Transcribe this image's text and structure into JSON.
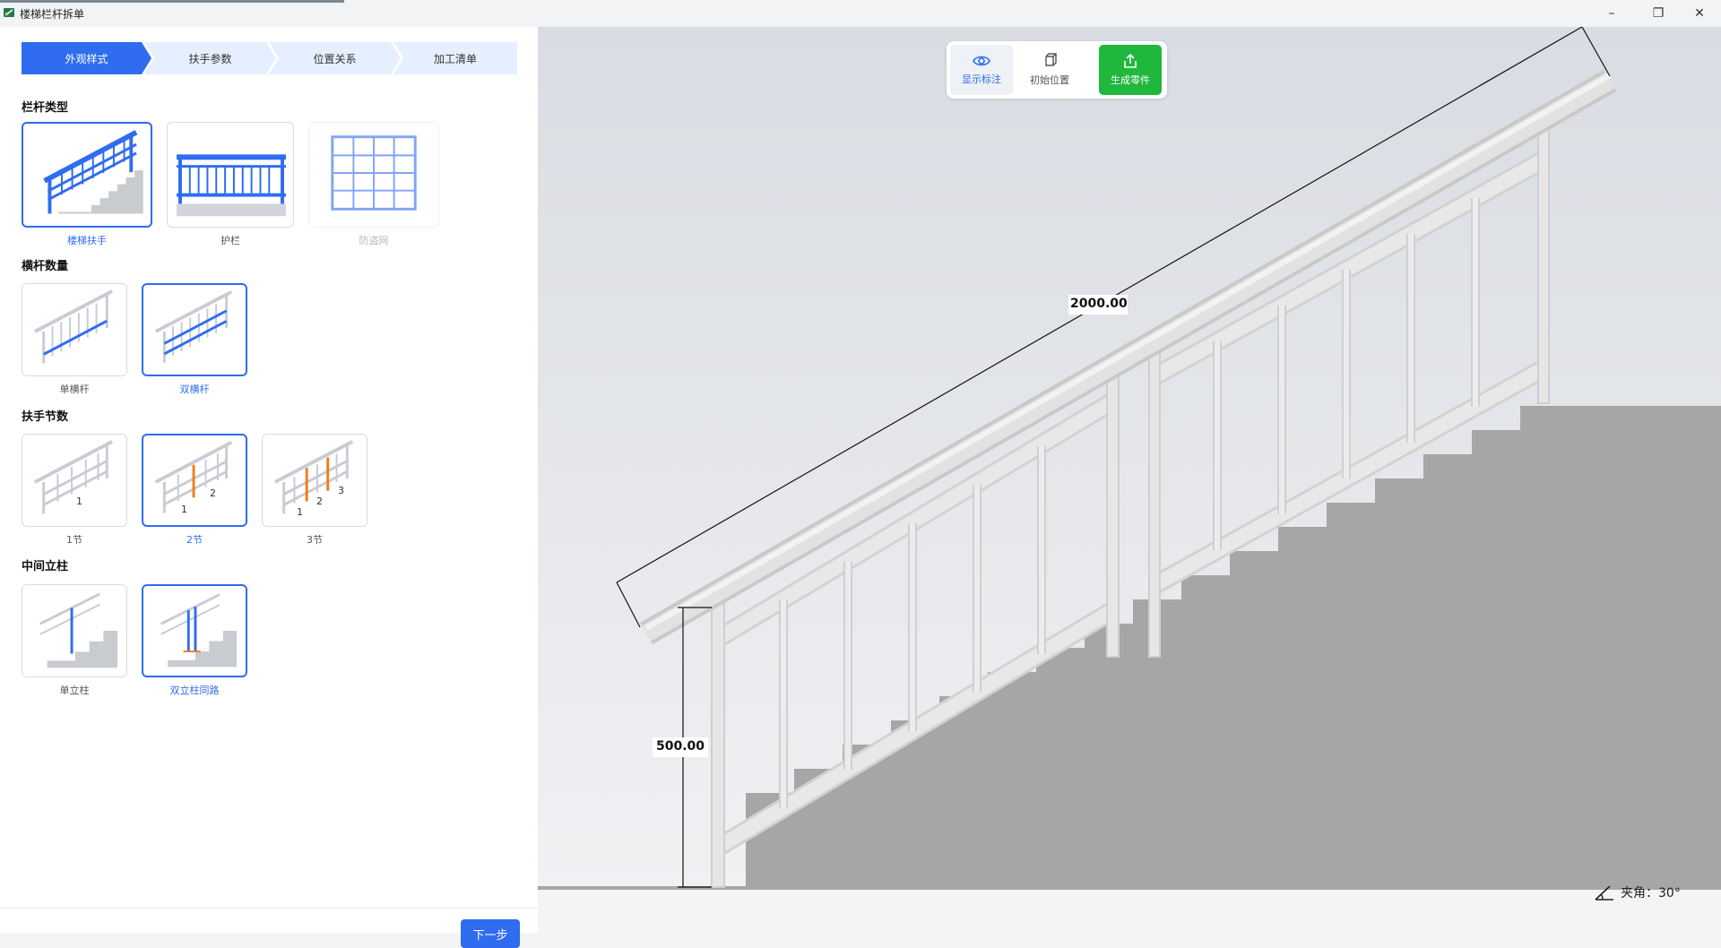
{
  "window": {
    "title": "楼梯栏杆拆单",
    "controls": {
      "minimize": "–",
      "maximize": "❐",
      "close": "✕"
    }
  },
  "steps": [
    {
      "label": "外观样式",
      "active": true
    },
    {
      "label": "扶手参数",
      "active": false
    },
    {
      "label": "位置关系",
      "active": false
    },
    {
      "label": "加工清单",
      "active": false
    }
  ],
  "sections": {
    "railing_type": {
      "title": "栏杆类型",
      "options": [
        {
          "label": "楼梯扶手",
          "state": "selected"
        },
        {
          "label": "护栏",
          "state": "normal"
        },
        {
          "label": "防盗网",
          "state": "disabled"
        }
      ]
    },
    "crossbar_count": {
      "title": "横杆数量",
      "options": [
        {
          "label": "单横杆",
          "state": "normal"
        },
        {
          "label": "双横杆",
          "state": "selected"
        }
      ]
    },
    "handrail_sections": {
      "title": "扶手节数",
      "options": [
        {
          "label": "1节",
          "state": "normal",
          "digits": [
            "1"
          ]
        },
        {
          "label": "2节",
          "state": "selected",
          "digits": [
            "1",
            "2"
          ]
        },
        {
          "label": "3节",
          "state": "normal",
          "digits": [
            "1",
            "2",
            "3"
          ]
        }
      ]
    },
    "middle_post": {
      "title": "中间立柱",
      "options": [
        {
          "label": "单立柱",
          "state": "normal"
        },
        {
          "label": "双立柱同路",
          "state": "selected"
        }
      ]
    }
  },
  "footer": {
    "next_label": "下一步"
  },
  "toolbar": {
    "show_annotation": "显示标注",
    "initial_position": "初始位置",
    "generate_parts": "生成零件"
  },
  "viewport": {
    "dim_length": "2000.00",
    "dim_height": "500.00",
    "angle_text": "夹角：30°"
  },
  "colors": {
    "accent": "#2f6cf0",
    "step_inactive": "#e6efff",
    "generate": "#1fb83c",
    "stairs": "#a6a6a6",
    "rail": "#e8e8e8",
    "section_marker": "#f07d1a"
  }
}
